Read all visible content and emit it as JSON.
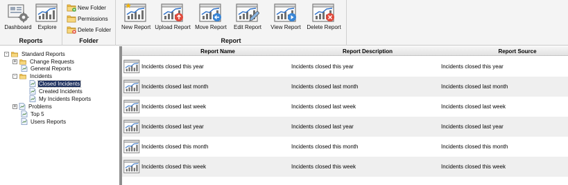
{
  "ribbon": {
    "reports_group": {
      "label": "Reports",
      "buttons": [
        {
          "label": "Dashboard",
          "icon": "dashboard-icon"
        },
        {
          "label": "Explore",
          "icon": "explore-chart-icon"
        }
      ]
    },
    "folder_group": {
      "label": "Folder",
      "buttons": [
        {
          "label": "New Folder",
          "icon": "new-folder-icon"
        },
        {
          "label": "Permissions",
          "icon": "permissions-folder-icon"
        },
        {
          "label": "Delete Folder",
          "icon": "delete-folder-icon"
        }
      ]
    },
    "report_group": {
      "label": "Report",
      "buttons": [
        {
          "label": "New Report",
          "icon": "new-report-icon"
        },
        {
          "label": "Upload Report",
          "icon": "upload-report-icon"
        },
        {
          "label": "Move Report",
          "icon": "move-report-icon"
        },
        {
          "label": "Edit Report",
          "icon": "edit-report-icon"
        },
        {
          "label": "View Report",
          "icon": "view-report-icon"
        },
        {
          "label": "Delete Report",
          "icon": "delete-report-icon"
        }
      ]
    }
  },
  "tree": {
    "root": "Standard Reports",
    "nodes": [
      {
        "label": "Change Requests",
        "type": "folder",
        "expander": "+"
      },
      {
        "label": "General Reports",
        "type": "report"
      },
      {
        "label": "Incidents",
        "type": "folder",
        "expander": "-"
      },
      {
        "label": "Closed Incidents",
        "type": "report",
        "selected": true
      },
      {
        "label": "Created Incidents",
        "type": "report"
      },
      {
        "label": "My Incidents Reports",
        "type": "report"
      },
      {
        "label": "Problems",
        "type": "report",
        "expander": "+"
      },
      {
        "label": "Top 5",
        "type": "report"
      },
      {
        "label": "Users Reports",
        "type": "report"
      }
    ]
  },
  "grid": {
    "columns": [
      "Report Name",
      "Report Description",
      "Report Source"
    ],
    "rows": [
      [
        "Incidents closed this year",
        "Incidents closed this year",
        "Incidents closed this year"
      ],
      [
        "Incidents closed last month",
        "Incidents closed last month",
        "Incidents closed last month"
      ],
      [
        "Incidents closed last week",
        "Incidents closed last week",
        "Incidents closed last week"
      ],
      [
        "Incidents closed last year",
        "Incidents closed last year",
        "Incidents closed last year"
      ],
      [
        "Incidents closed this month",
        "Incidents closed this month",
        "Incidents closed this month"
      ],
      [
        "Incidents closed this week",
        "Incidents closed this week",
        "Incidents closed this week"
      ]
    ]
  },
  "colors": {
    "ribbon_bg": "#f4f4f4",
    "selected_node_bg": "#1c2f5e",
    "alt_row_bg": "#efefef",
    "splitter": "#8e8e8e",
    "folder": "#f2c14e"
  }
}
